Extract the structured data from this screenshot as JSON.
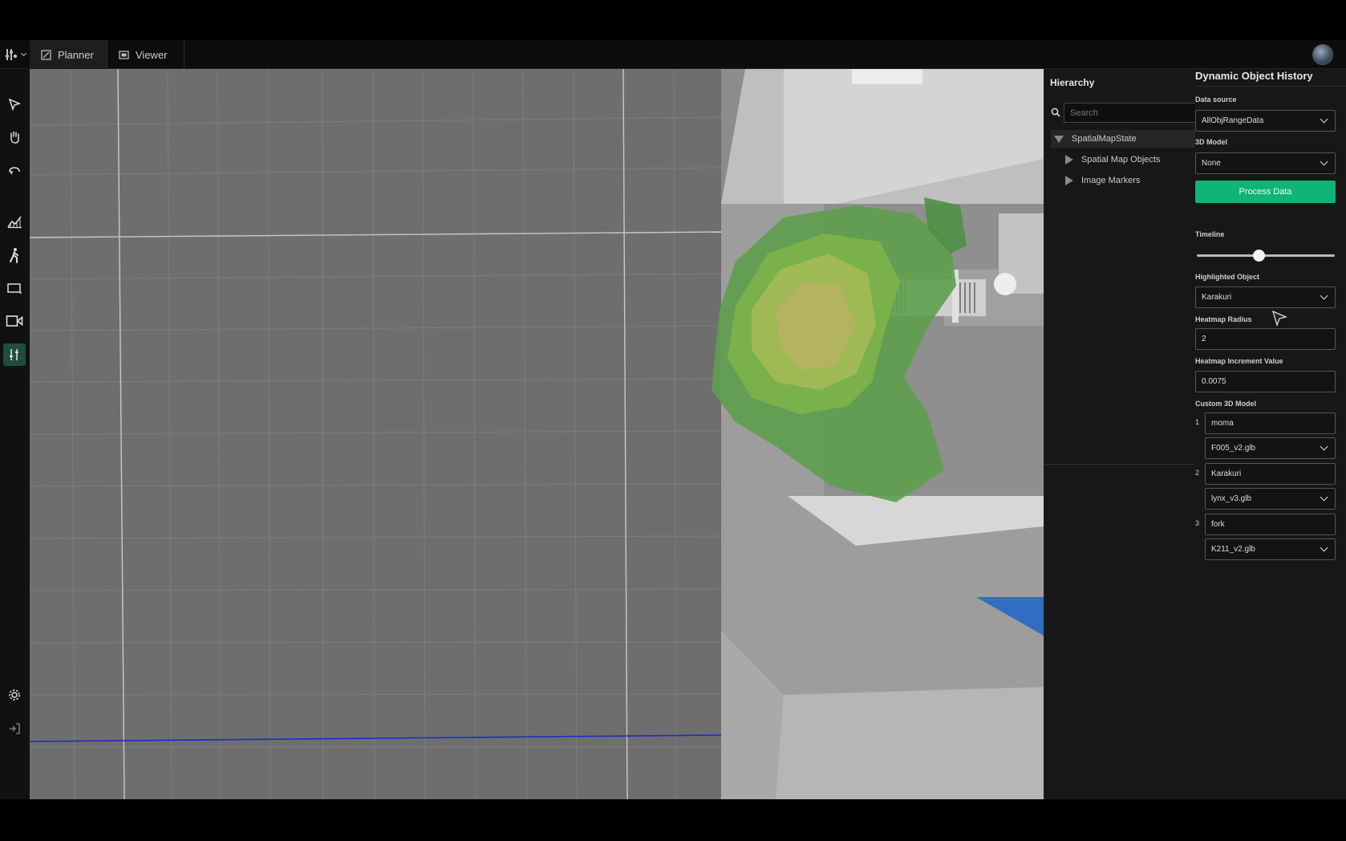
{
  "tabs": [
    {
      "label": "Planner",
      "icon": "planner-icon"
    },
    {
      "label": "Viewer",
      "icon": "viewer-icon"
    }
  ],
  "toolbar": {
    "tools": [
      "select-icon",
      "hand-icon",
      "orbit-icon",
      "chart-icon",
      "walk-icon",
      "rectangle-icon",
      "video-icon",
      "sliders-icon"
    ],
    "bottom_tools": [
      "settings-icon",
      "logout-icon"
    ],
    "active_color": "#1f4d3f"
  },
  "hierarchy": {
    "title": "Hierarchy",
    "search_placeholder": "Search",
    "items": [
      {
        "label": "SpatialMapState"
      },
      {
        "label": "Spatial Map Objects"
      },
      {
        "label": "Image Markers"
      }
    ]
  },
  "panel": {
    "title": "Dynamic Object History",
    "data_source_label": "Data source",
    "data_source_value": "AllObjRangeData",
    "model_label": "3D Model",
    "model_value": "None",
    "process_button": "Process Data",
    "timeline_label": "Timeline",
    "timeline_value": 0.45,
    "highlighted_label": "Highlighted Object",
    "highlighted_value": "Karakuri",
    "radius_label": "Heatmap Radius",
    "radius_value": "2",
    "increment_label": "Heatmap Increment Value",
    "increment_value": "0.0075",
    "custom_label": "Custom 3D Model",
    "custom_models": [
      {
        "index": "1",
        "name": "moma",
        "file": "F005_v2.glb"
      },
      {
        "index": "2",
        "name": "Karakuri",
        "file": "lynx_v3.glb"
      },
      {
        "index": "3",
        "name": "fork",
        "file": "K211_v2.glb"
      }
    ],
    "accent_color": "#0fb478"
  }
}
